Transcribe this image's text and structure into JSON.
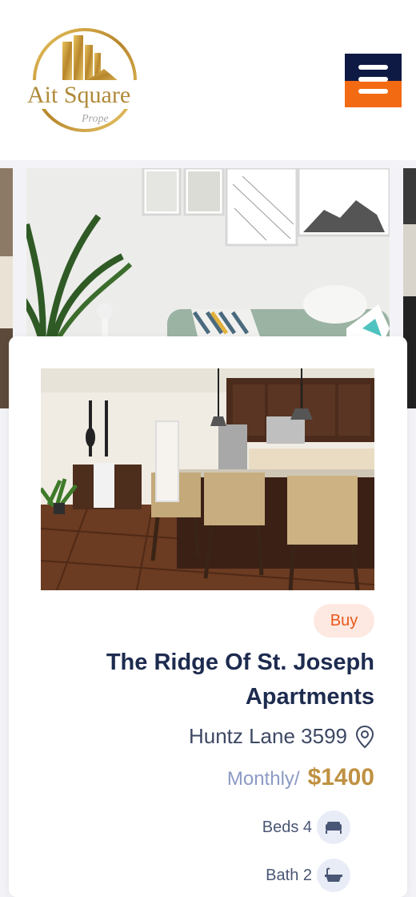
{
  "header": {
    "logo_icon": "ait-square-logo",
    "logo_alt": "Ait Square Properties",
    "menu_icon": "hamburger-menu-icon"
  },
  "listing": {
    "badge": "Buy",
    "title": "The Ridge Of St. Joseph Apartments",
    "address": "Huntz Lane 3599",
    "price_label": "Monthly/",
    "price": "$1400",
    "beds": "Beds 4",
    "bath": "Bath 2"
  },
  "colors": {
    "brand_navy": "#0f1a44",
    "brand_orange": "#f26a12",
    "gold": "#bf9142",
    "badge_bg": "#fde9e1",
    "badge_text": "#e8591a"
  }
}
